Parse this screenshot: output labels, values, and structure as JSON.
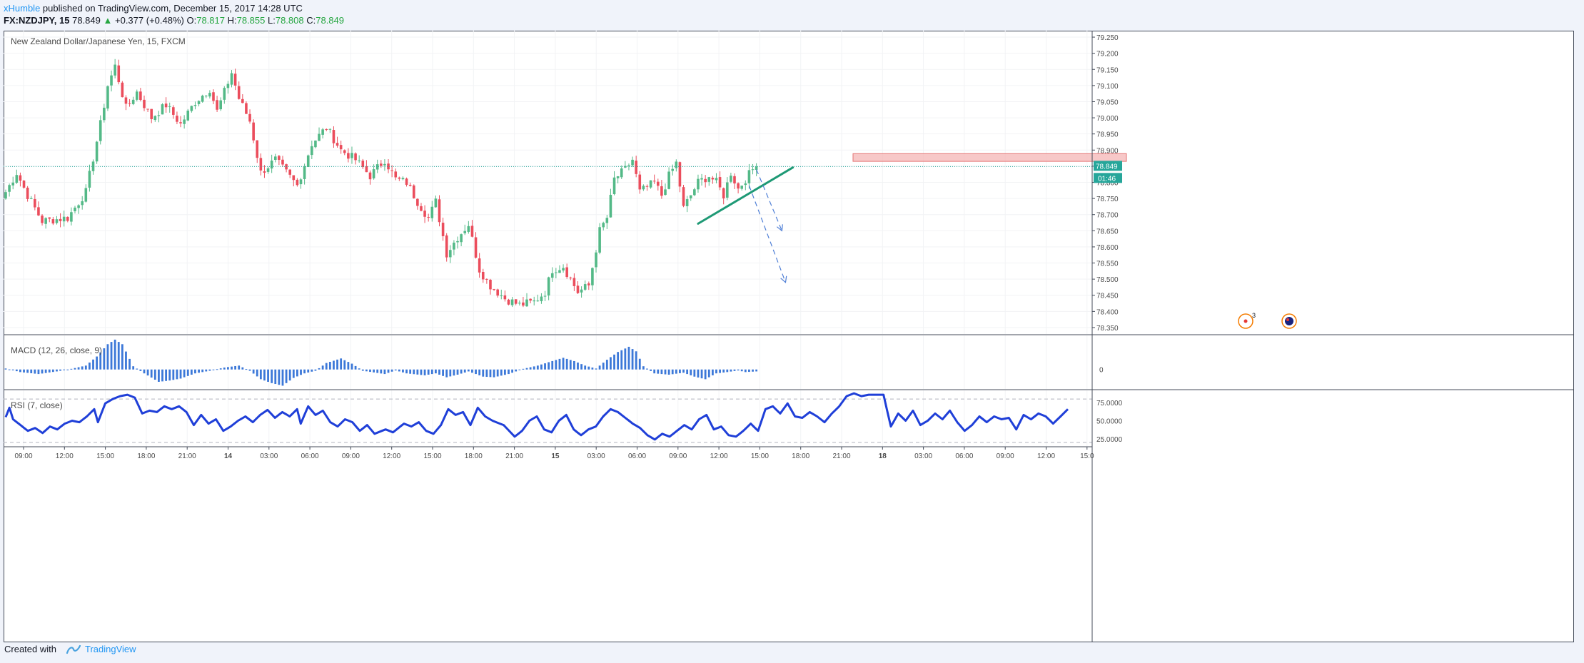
{
  "header": {
    "author": "xHumble",
    "published_text": "published on TradingView.com, December 15, 2017 14:28 UTC",
    "symbol": "FX:NZDJPY, 15",
    "last": "78.849",
    "change_arrow": "▲",
    "change": "+0.377 (+0.48%)",
    "open_label": "O:",
    "open": "78.817",
    "high_label": "H:",
    "high": "78.855",
    "low_label": "L:",
    "low": "78.808",
    "close_label": "C:",
    "close": "78.849"
  },
  "colors": {
    "up": "#53b987",
    "down": "#eb4d5c",
    "indicator": "#1f3fd8",
    "macd": "#3c78d8",
    "trendline": "#1e9975",
    "resistance_fill": "#f4b6b6",
    "resistance_stroke": "#e57373",
    "projection": "#4f7fd6",
    "price_line": "#26a69a"
  },
  "footer": {
    "created_with": "Created with",
    "brand": "TradingView"
  },
  "chart_data": [
    {
      "type": "candlestick",
      "title": "New Zealand Dollar/Japanese Yen, 15, FXCM",
      "ylim": [
        78.33,
        79.27
      ],
      "y_ticks": [
        "79.250",
        "79.200",
        "79.150",
        "79.100",
        "79.050",
        "79.000",
        "78.950",
        "78.900",
        "78.850",
        "78.800",
        "78.750",
        "78.700",
        "78.650",
        "78.600",
        "78.550",
        "78.500",
        "78.450",
        "78.400",
        "78.350"
      ],
      "current_price": "78.849",
      "countdown": "01:46",
      "x_ticks": [
        "09:00",
        "12:00",
        "15:00",
        "18:00",
        "21:00",
        "14",
        "03:00",
        "06:00",
        "09:00",
        "12:00",
        "15:00",
        "18:00",
        "21:00",
        "15",
        "03:00",
        "06:00",
        "09:00",
        "12:00",
        "15:00",
        "18:00",
        "21:00",
        "18",
        "03:00",
        "06:00",
        "09:00",
        "12:00",
        "15:0"
      ],
      "close_anchors": [
        [
          0,
          78.77
        ],
        [
          3,
          78.83
        ],
        [
          6,
          78.76
        ],
        [
          10,
          78.68
        ],
        [
          17,
          78.69
        ],
        [
          22,
          78.77
        ],
        [
          26,
          78.98
        ],
        [
          28,
          79.1
        ],
        [
          30,
          79.16
        ],
        [
          33,
          79.03
        ],
        [
          36,
          79.08
        ],
        [
          40,
          79.0
        ],
        [
          44,
          79.04
        ],
        [
          48,
          78.98
        ],
        [
          52,
          79.05
        ],
        [
          56,
          79.09
        ],
        [
          58,
          79.02
        ],
        [
          62,
          79.14
        ],
        [
          64,
          79.06
        ],
        [
          67,
          78.99
        ],
        [
          70,
          78.83
        ],
        [
          74,
          78.87
        ],
        [
          77,
          78.83
        ],
        [
          80,
          78.79
        ],
        [
          84,
          78.92
        ],
        [
          88,
          78.97
        ],
        [
          92,
          78.9
        ],
        [
          96,
          78.87
        ],
        [
          100,
          78.82
        ],
        [
          104,
          78.87
        ],
        [
          107,
          78.81
        ],
        [
          110,
          78.8
        ],
        [
          113,
          78.74
        ],
        [
          116,
          78.69
        ],
        [
          118,
          78.74
        ],
        [
          121,
          78.58
        ],
        [
          124,
          78.63
        ],
        [
          127,
          78.67
        ],
        [
          130,
          78.53
        ],
        [
          133,
          78.48
        ],
        [
          137,
          78.44
        ],
        [
          141,
          78.42
        ],
        [
          145,
          78.43
        ],
        [
          148,
          78.46
        ],
        [
          150,
          78.53
        ],
        [
          153,
          78.54
        ],
        [
          157,
          78.46
        ],
        [
          160,
          78.48
        ],
        [
          163,
          78.65
        ],
        [
          165,
          78.69
        ],
        [
          167,
          78.81
        ],
        [
          170,
          78.84
        ],
        [
          172,
          78.87
        ],
        [
          174,
          78.77
        ],
        [
          178,
          78.8
        ],
        [
          180,
          78.76
        ],
        [
          182,
          78.82
        ],
        [
          184,
          78.86
        ],
        [
          186,
          78.72
        ],
        [
          188,
          78.76
        ],
        [
          190,
          78.8
        ],
        [
          193,
          78.82
        ],
        [
          195,
          78.8
        ],
        [
          197,
          78.76
        ],
        [
          199,
          78.83
        ],
        [
          201,
          78.78
        ],
        [
          203,
          78.81
        ],
        [
          205,
          78.84
        ],
        [
          206,
          78.849
        ]
      ],
      "annotations": {
        "resistance_zone": [
          78.865,
          78.889
        ],
        "trendline": {
          "from": [
            190,
            78.672
          ],
          "to": [
            216,
            78.846
          ]
        },
        "projection_1": {
          "from": [
            206,
            78.84
          ],
          "to": [
            213,
            78.65
          ]
        },
        "projection_2": {
          "from": [
            204,
            78.79
          ],
          "to": [
            214,
            78.49
          ]
        }
      },
      "events": {
        "badge_count": "3"
      }
    },
    {
      "type": "bar",
      "title": "MACD (12, 26, close, 9)",
      "ylim": [
        -0.06,
        0.105
      ],
      "y_ticks": [
        "0"
      ],
      "value_anchors": [
        [
          0,
          0.003
        ],
        [
          4,
          -0.008
        ],
        [
          9,
          -0.014
        ],
        [
          14,
          -0.006
        ],
        [
          18,
          0.002
        ],
        [
          22,
          0.012
        ],
        [
          25,
          0.04
        ],
        [
          28,
          0.078
        ],
        [
          30,
          0.092
        ],
        [
          32,
          0.078
        ],
        [
          35,
          0.01
        ],
        [
          38,
          -0.012
        ],
        [
          42,
          -0.038
        ],
        [
          45,
          -0.034
        ],
        [
          48,
          -0.028
        ],
        [
          52,
          -0.012
        ],
        [
          56,
          -0.004
        ],
        [
          60,
          0.006
        ],
        [
          64,
          0.012
        ],
        [
          67,
          -0.004
        ],
        [
          70,
          -0.03
        ],
        [
          73,
          -0.042
        ],
        [
          76,
          -0.05
        ],
        [
          79,
          -0.026
        ],
        [
          82,
          -0.012
        ],
        [
          85,
          -0.004
        ],
        [
          88,
          0.02
        ],
        [
          92,
          0.034
        ],
        [
          95,
          0.018
        ],
        [
          98,
          -0.004
        ],
        [
          104,
          -0.014
        ],
        [
          107,
          -0.003
        ],
        [
          110,
          -0.012
        ],
        [
          115,
          -0.018
        ],
        [
          118,
          -0.012
        ],
        [
          121,
          -0.024
        ],
        [
          124,
          -0.016
        ],
        [
          127,
          -0.006
        ],
        [
          131,
          -0.022
        ],
        [
          134,
          -0.024
        ],
        [
          138,
          -0.014
        ],
        [
          142,
          0.002
        ],
        [
          146,
          0.012
        ],
        [
          150,
          0.026
        ],
        [
          153,
          0.036
        ],
        [
          156,
          0.026
        ],
        [
          159,
          0.012
        ],
        [
          162,
          0.003
        ],
        [
          165,
          0.03
        ],
        [
          168,
          0.054
        ],
        [
          171,
          0.07
        ],
        [
          173,
          0.056
        ],
        [
          175,
          0.01
        ],
        [
          178,
          -0.012
        ],
        [
          182,
          -0.016
        ],
        [
          186,
          -0.01
        ],
        [
          189,
          -0.022
        ],
        [
          192,
          -0.03
        ],
        [
          195,
          -0.012
        ],
        [
          198,
          -0.008
        ],
        [
          201,
          -0.003
        ],
        [
          203,
          -0.008
        ],
        [
          206,
          -0.006
        ]
      ]
    },
    {
      "type": "line",
      "title": "RSI (7, close)",
      "ylim": [
        15,
        92
      ],
      "y_ticks": [
        "75.0000",
        "50.0000",
        "25.0000"
      ],
      "bands": [
        80,
        20
      ],
      "value_anchors": [
        [
          0,
          55
        ],
        [
          1,
          68
        ],
        [
          2,
          52
        ],
        [
          4,
          44
        ],
        [
          6,
          36
        ],
        [
          8,
          40
        ],
        [
          10,
          33
        ],
        [
          12,
          42
        ],
        [
          14,
          38
        ],
        [
          16,
          46
        ],
        [
          18,
          50
        ],
        [
          20,
          48
        ],
        [
          22,
          56
        ],
        [
          24,
          66
        ],
        [
          25,
          48
        ],
        [
          27,
          74
        ],
        [
          29,
          80
        ],
        [
          31,
          84
        ],
        [
          33,
          86
        ],
        [
          35,
          82
        ],
        [
          37,
          60
        ],
        [
          39,
          64
        ],
        [
          41,
          62
        ],
        [
          43,
          70
        ],
        [
          45,
          66
        ],
        [
          47,
          70
        ],
        [
          49,
          62
        ],
        [
          51,
          44
        ],
        [
          53,
          58
        ],
        [
          55,
          46
        ],
        [
          57,
          52
        ],
        [
          59,
          36
        ],
        [
          61,
          42
        ],
        [
          63,
          50
        ],
        [
          65,
          56
        ],
        [
          67,
          48
        ],
        [
          69,
          58
        ],
        [
          71,
          65
        ],
        [
          73,
          54
        ],
        [
          75,
          62
        ],
        [
          77,
          56
        ],
        [
          79,
          66
        ],
        [
          80,
          46
        ],
        [
          82,
          70
        ],
        [
          84,
          58
        ],
        [
          86,
          64
        ],
        [
          88,
          48
        ],
        [
          90,
          42
        ],
        [
          92,
          52
        ],
        [
          94,
          48
        ],
        [
          96,
          36
        ],
        [
          98,
          44
        ],
        [
          100,
          32
        ],
        [
          103,
          38
        ],
        [
          105,
          34
        ],
        [
          108,
          46
        ],
        [
          110,
          42
        ],
        [
          112,
          48
        ],
        [
          114,
          36
        ],
        [
          116,
          32
        ],
        [
          118,
          44
        ],
        [
          120,
          66
        ],
        [
          122,
          58
        ],
        [
          124,
          62
        ],
        [
          126,
          44
        ],
        [
          128,
          68
        ],
        [
          130,
          56
        ],
        [
          132,
          50
        ],
        [
          135,
          44
        ],
        [
          138,
          28
        ],
        [
          140,
          36
        ],
        [
          142,
          50
        ],
        [
          144,
          56
        ],
        [
          146,
          38
        ],
        [
          148,
          34
        ],
        [
          150,
          50
        ],
        [
          152,
          58
        ],
        [
          154,
          38
        ],
        [
          156,
          30
        ],
        [
          158,
          38
        ],
        [
          160,
          42
        ],
        [
          162,
          56
        ],
        [
          164,
          66
        ],
        [
          166,
          62
        ],
        [
          168,
          54
        ],
        [
          170,
          46
        ],
        [
          172,
          40
        ],
        [
          174,
          30
        ],
        [
          176,
          24
        ],
        [
          178,
          32
        ],
        [
          180,
          28
        ],
        [
          182,
          36
        ],
        [
          184,
          44
        ],
        [
          186,
          38
        ],
        [
          188,
          52
        ],
        [
          190,
          58
        ],
        [
          192,
          38
        ],
        [
          194,
          42
        ],
        [
          196,
          30
        ],
        [
          198,
          28
        ],
        [
          200,
          36
        ],
        [
          202,
          46
        ],
        [
          204,
          36
        ],
        [
          206,
          66
        ],
        [
          208,
          70
        ],
        [
          210,
          60
        ],
        [
          212,
          74
        ],
        [
          214,
          56
        ],
        [
          216,
          54
        ],
        [
          218,
          62
        ],
        [
          220,
          56
        ],
        [
          222,
          48
        ],
        [
          224,
          60
        ],
        [
          226,
          70
        ],
        [
          228,
          84
        ],
        [
          230,
          88
        ],
        [
          232,
          84
        ],
        [
          234,
          86
        ],
        [
          236,
          86
        ],
        [
          238,
          86
        ],
        [
          240,
          42
        ],
        [
          242,
          60
        ],
        [
          244,
          50
        ],
        [
          246,
          64
        ],
        [
          248,
          44
        ],
        [
          250,
          50
        ],
        [
          252,
          60
        ],
        [
          254,
          52
        ],
        [
          256,
          64
        ],
        [
          258,
          48
        ],
        [
          260,
          36
        ],
        [
          262,
          44
        ],
        [
          264,
          56
        ],
        [
          266,
          48
        ],
        [
          268,
          56
        ],
        [
          270,
          52
        ],
        [
          272,
          54
        ],
        [
          274,
          38
        ],
        [
          276,
          58
        ],
        [
          278,
          52
        ],
        [
          280,
          60
        ],
        [
          282,
          56
        ],
        [
          284,
          46
        ],
        [
          286,
          56
        ],
        [
          288,
          66
        ]
      ]
    }
  ]
}
